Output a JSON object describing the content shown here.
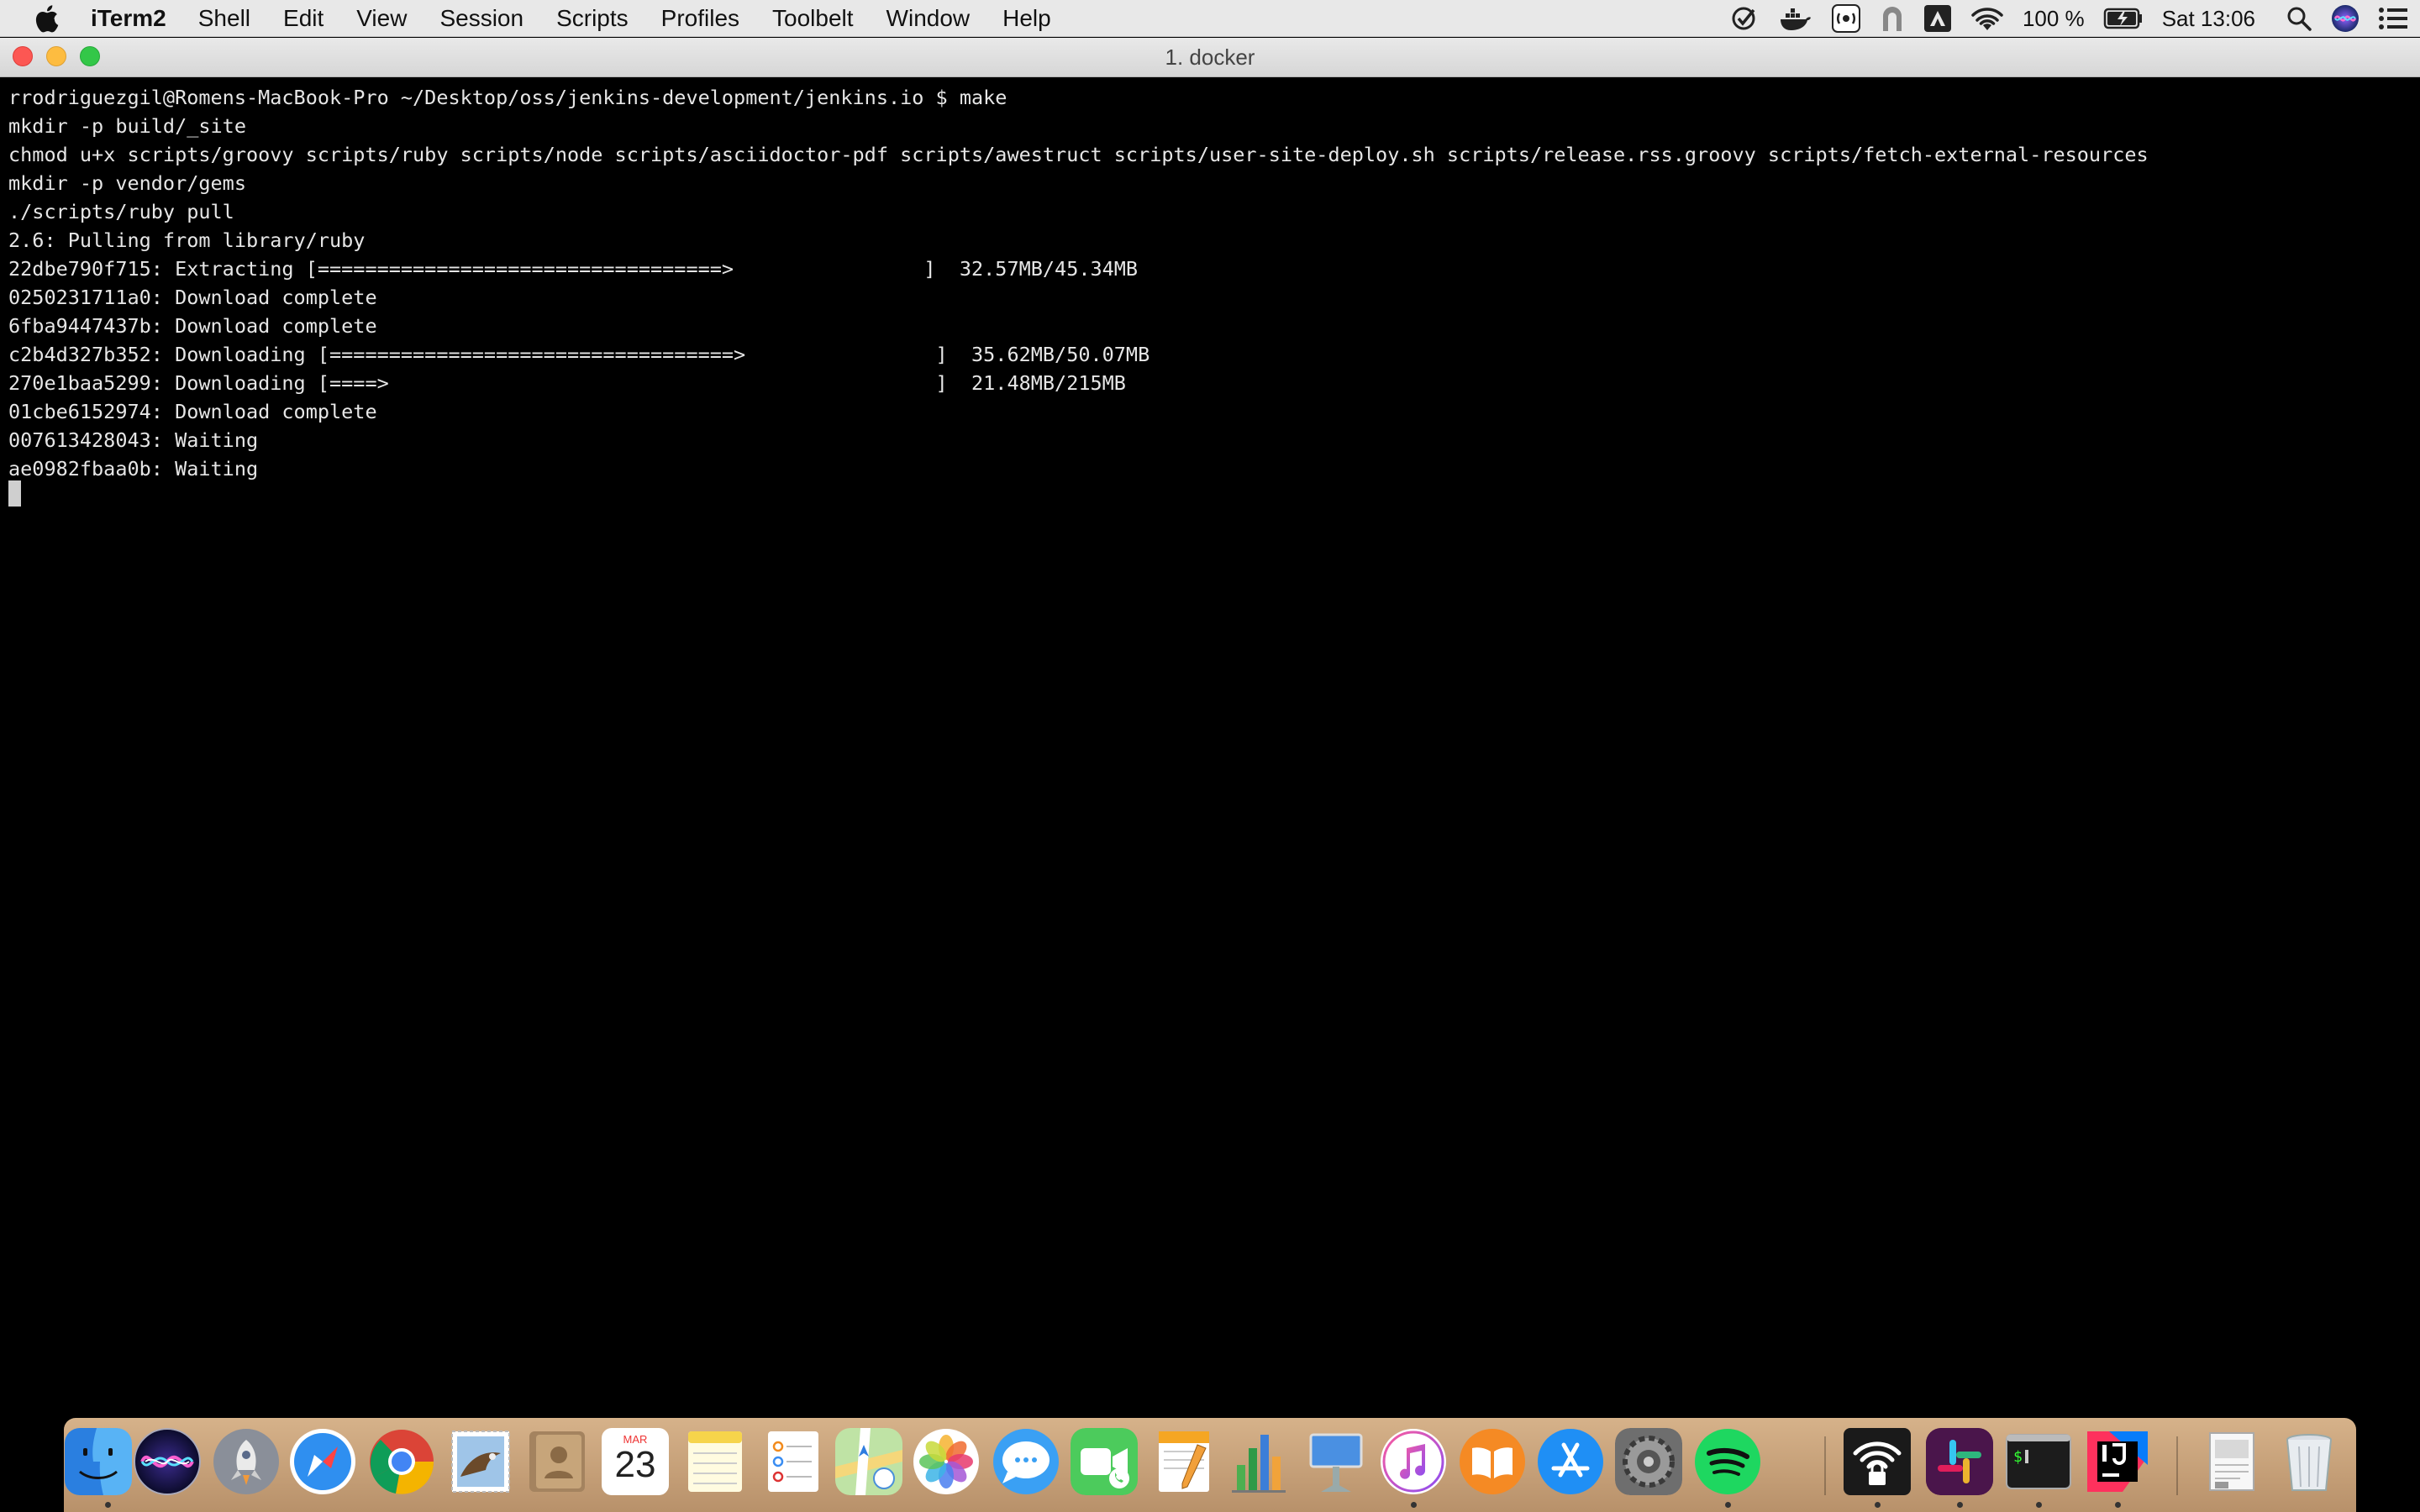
{
  "menubar": {
    "app_name": "iTerm2",
    "menus": [
      "Shell",
      "Edit",
      "View",
      "Session",
      "Scripts",
      "Profiles",
      "Toolbelt",
      "Window",
      "Help"
    ],
    "battery": "100 %",
    "clock": "Sat 13:06"
  },
  "window": {
    "title": "1. docker"
  },
  "terminal": {
    "lines": [
      "rrodriguezgil@Romens-MacBook-Pro ~/Desktop/oss/jenkins-development/jenkins.io $ make",
      "mkdir -p build/_site",
      "chmod u+x scripts/groovy scripts/ruby scripts/node scripts/asciidoctor-pdf scripts/awestruct scripts/user-site-deploy.sh scripts/release.rss.groovy scripts/fetch-external-resources",
      "mkdir -p vendor/gems",
      "./scripts/ruby pull",
      "2.6: Pulling from library/ruby",
      "22dbe790f715: Extracting [==================================>                ]  32.57MB/45.34MB",
      "0250231711a0: Download complete",
      "6fba9447437b: Download complete",
      "c2b4d327b352: Downloading [==================================>                ]  35.62MB/50.07MB",
      "270e1baa5299: Downloading [====>                                              ]  21.48MB/215MB",
      "01cbe6152974: Download complete",
      "007613428043: Waiting",
      "ae0982fbaa0b: Waiting"
    ]
  },
  "dock": {
    "calendar_month": "MAR",
    "calendar_day": "23",
    "apps": [
      "finder",
      "siri",
      "launchpad",
      "safari",
      "chrome",
      "mail",
      "contacts",
      "calendar",
      "notes",
      "reminders",
      "maps",
      "photos",
      "messages",
      "facetime",
      "pages",
      "numbers",
      "keynote",
      "itunes",
      "books",
      "app-store",
      "system-preferences",
      "spotify",
      "vpn",
      "slack",
      "terminal",
      "intellij",
      "documents",
      "trash"
    ]
  },
  "colors": {
    "terminal_bg": "#000000",
    "terminal_fg": "#e6e6e6",
    "menubar_bg": "#e8e8e8",
    "dock_bg": "#c9a37a"
  }
}
